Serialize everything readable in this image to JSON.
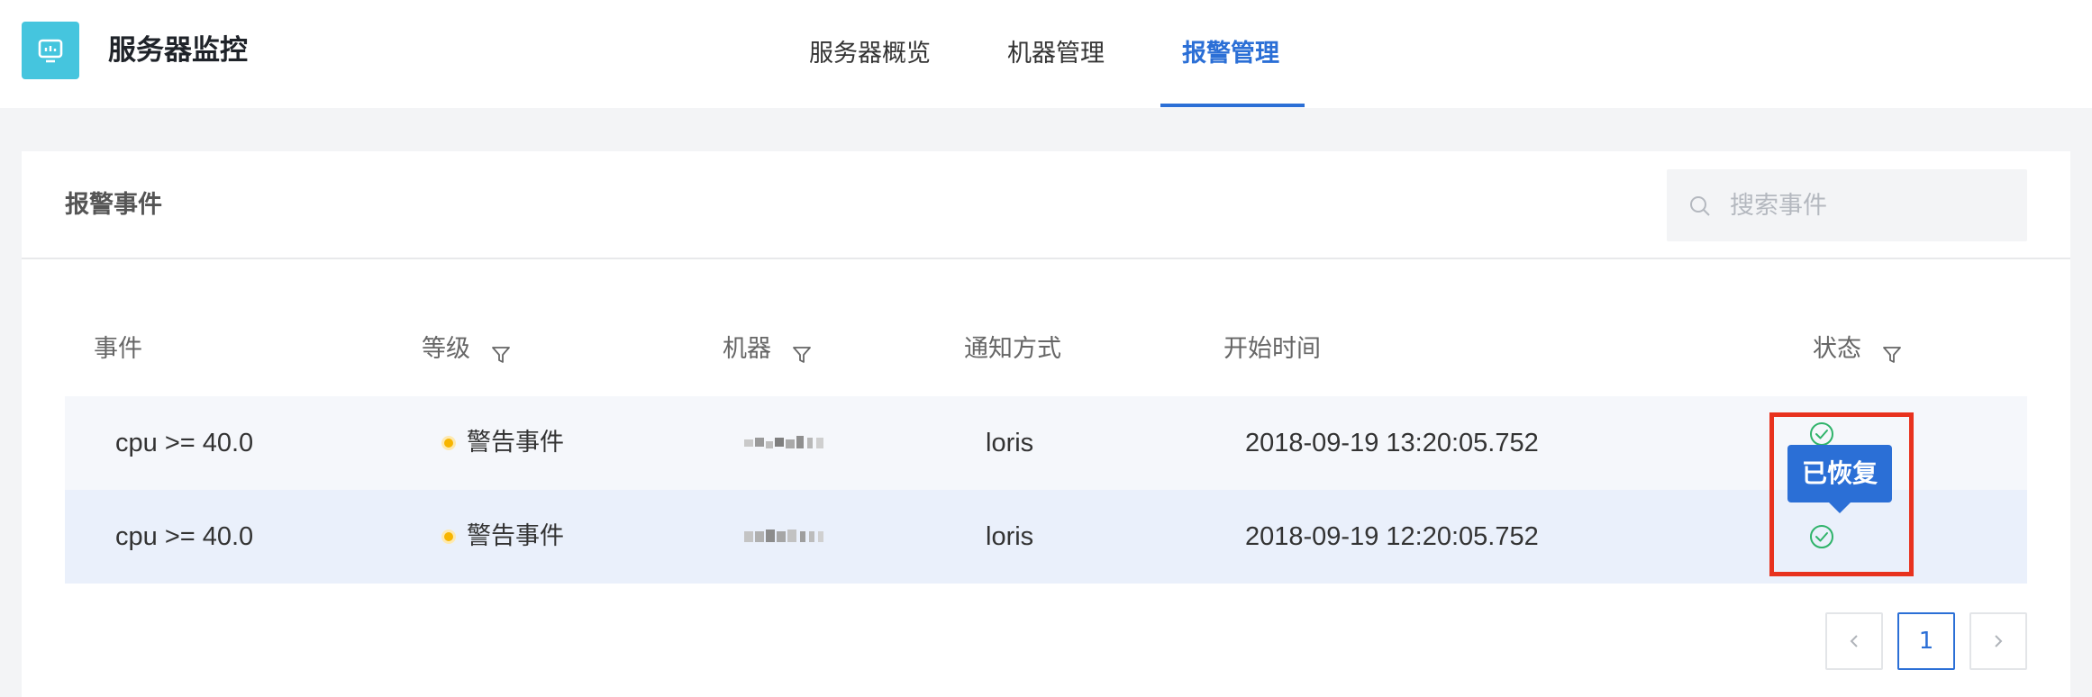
{
  "app": {
    "title": "服务器监控",
    "logo_icon": "monitor-icon",
    "brand_color": "#45c5de"
  },
  "nav": {
    "tabs": [
      {
        "label": "服务器概览",
        "active": false
      },
      {
        "label": "机器管理",
        "active": false
      },
      {
        "label": "报警管理",
        "active": true
      }
    ],
    "accent_color": "#2b6fd6"
  },
  "panel": {
    "title": "报警事件",
    "search": {
      "placeholder": "搜索事件",
      "value": ""
    }
  },
  "table": {
    "columns": [
      {
        "label": "事件",
        "filterable": false
      },
      {
        "label": "等级",
        "filterable": true
      },
      {
        "label": "机器",
        "filterable": true
      },
      {
        "label": "通知方式",
        "filterable": false
      },
      {
        "label": "开始时间",
        "filterable": false
      },
      {
        "label": "状态",
        "filterable": true
      }
    ],
    "rows": [
      {
        "event": "cpu >= 40.0",
        "level": "警告事件",
        "level_color": "#f7b500",
        "machine": "(obscured)",
        "notify": "loris",
        "start_time": "2018-09-19 13:20:05.752",
        "status_icon": "check-circle-icon"
      },
      {
        "event": "cpu >= 40.0",
        "level": "警告事件",
        "level_color": "#f7b500",
        "machine": "(obscured)",
        "notify": "loris",
        "start_time": "2018-09-19 12:20:05.752",
        "status_icon": "check-circle-icon"
      }
    ]
  },
  "tooltip": {
    "text": "已恢复"
  },
  "pagination": {
    "prev_icon": "chevron-left-icon",
    "current_page": "1",
    "next_icon": "chevron-right-icon"
  }
}
